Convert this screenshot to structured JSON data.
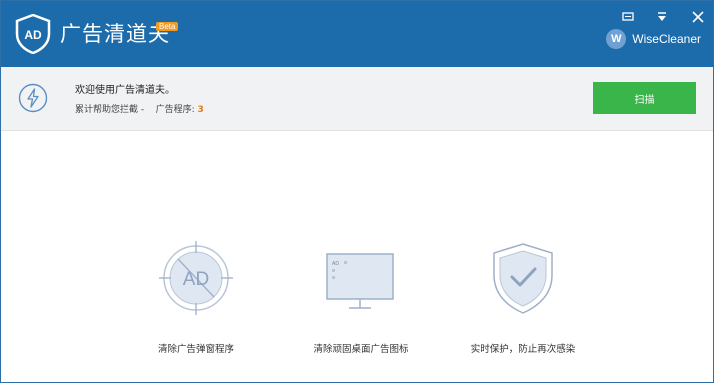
{
  "titlebar": {
    "app_title": "广告清道夫",
    "beta_badge": "Beta",
    "brand_name": "WiseCleaner",
    "brand_initial": "W",
    "logo_text": "AD"
  },
  "infobar": {
    "welcome_text": "欢迎使用广告清道夫。",
    "stats_prefix": "累计帮助您拦截 -",
    "ads_label": "广告程序:",
    "ads_count": "3",
    "scan_button": "扫描"
  },
  "features": [
    {
      "label": "清除广告弹窗程序",
      "icon": "ad-target-icon",
      "icon_text": "AD"
    },
    {
      "label": "清除顽固桌面广告图标",
      "icon": "monitor-icon",
      "icon_text": "AD"
    },
    {
      "label": "实时保护，防止再次感染",
      "icon": "shield-check-icon"
    }
  ],
  "colors": {
    "titlebar": "#1c6bab",
    "accent_green": "#3ab54a",
    "count_orange": "#e37c13",
    "beta_orange": "#f39a1e"
  }
}
